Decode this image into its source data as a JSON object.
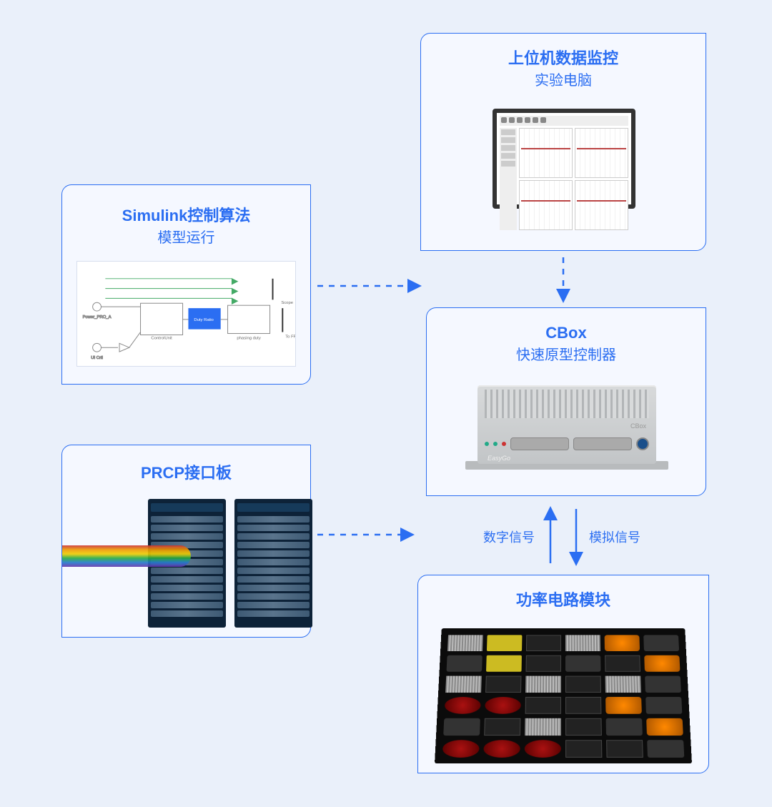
{
  "colors": {
    "accent": "#2b6ef2",
    "bg": "#eaf0fa",
    "card": "#f5f8ff"
  },
  "simulink": {
    "title": "Simulink控制算法",
    "subtitle": "模型运行"
  },
  "monitor": {
    "title": "上位机数据监控",
    "subtitle": "实验电脑"
  },
  "cbox": {
    "title": "CBox",
    "subtitle": "快速原型控制器",
    "brand": "EasyGo",
    "model": "CBox"
  },
  "prcp": {
    "title": "PRCP接口板"
  },
  "power": {
    "title": "功率电路模块"
  },
  "flows": {
    "digital": "数字信号",
    "analog": "模拟信号"
  }
}
